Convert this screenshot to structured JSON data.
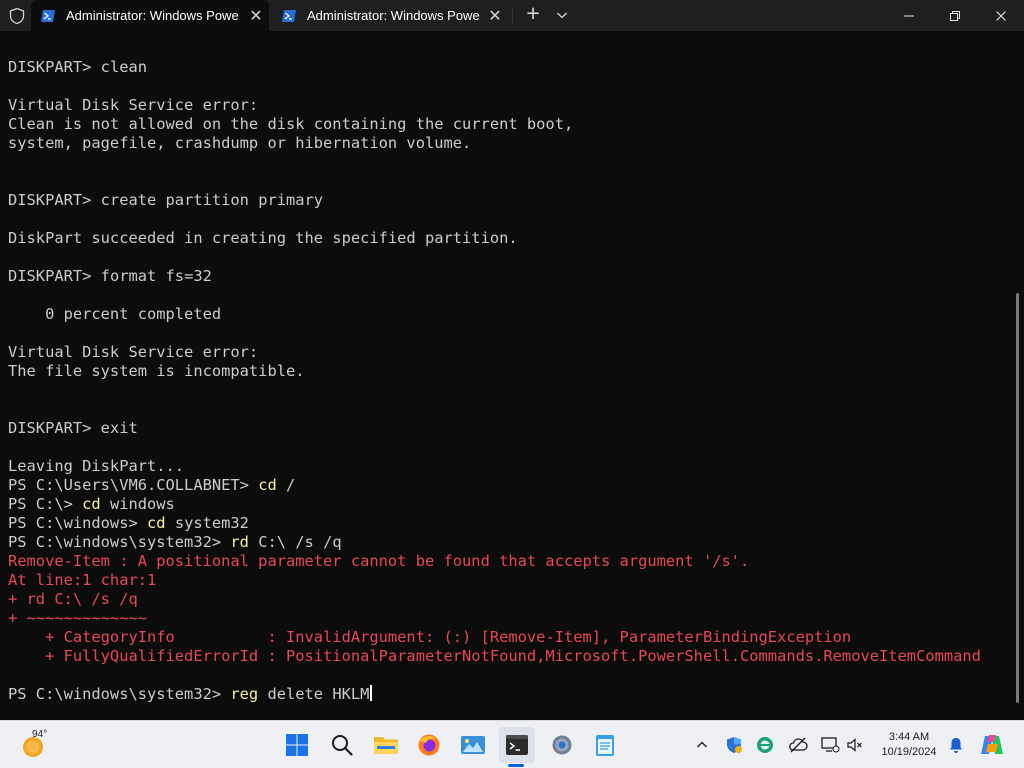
{
  "window": {
    "tabs": [
      {
        "label": "Administrator: Windows Powe",
        "close": "✕"
      },
      {
        "label": "Administrator: Windows Powe",
        "close": "✕"
      }
    ],
    "new_tab": "+",
    "icons": [
      "shield-icon",
      "powershell-icon",
      "chevron-down-icon",
      "minimize-icon",
      "maximize-icon",
      "close-icon"
    ]
  },
  "terminal": {
    "lines": [
      {
        "prompt": "DISKPART> ",
        "cmd": "clean"
      },
      {
        "text": "Virtual Disk Service error:"
      },
      {
        "text": "Clean is not allowed on the disk containing the current boot,"
      },
      {
        "text": "system, pagefile, crashdump or hibernation volume."
      },
      {
        "prompt": "DISKPART> ",
        "cmd": "create partition primary"
      },
      {
        "text": "DiskPart succeeded in creating the specified partition."
      },
      {
        "prompt": "DISKPART> ",
        "cmd": "format fs=32"
      },
      {
        "text": "    0 percent completed"
      },
      {
        "text": "Virtual Disk Service error:"
      },
      {
        "text": "The file system is incompatible."
      },
      {
        "prompt": "DISKPART> ",
        "cmd": "exit"
      },
      {
        "text": "Leaving DiskPart..."
      },
      {
        "prompt": "PS C:\\Users\\VM6.COLLABNET> ",
        "cmd": "cd",
        "arg": " /"
      },
      {
        "prompt": "PS C:\\> ",
        "cmd": "cd",
        "arg": " windows"
      },
      {
        "prompt": "PS C:\\windows> ",
        "cmd": "cd",
        "arg": " system32"
      },
      {
        "prompt": "PS C:\\windows\\system32> ",
        "cmd": "rd",
        "arg": " C:\\ /s /q"
      },
      {
        "error": "Remove-Item : A positional parameter cannot be found that accepts argument '/s'."
      },
      {
        "error": "At line:1 char:1"
      },
      {
        "error": "+ rd C:\\ /s /q"
      },
      {
        "error": "+ ~~~~~~~~~~~~~"
      },
      {
        "error": "    + CategoryInfo          : InvalidArgument: (:) [Remove-Item], ParameterBindingException"
      },
      {
        "error": "    + FullyQualifiedErrorId : PositionalParameterNotFound,Microsoft.PowerShell.Commands.RemoveItemCommand"
      },
      {
        "prompt": "PS C:\\windows\\system32> ",
        "cmd": "reg",
        "arg": " delete HKLM"
      }
    ],
    "colors": {
      "text": "#cccccc",
      "command": "#f9f1a5",
      "error": "#e74856",
      "background": "#0c0c0c"
    }
  },
  "taskbar": {
    "weather_temp": "94°",
    "apps": [
      "windows-start-icon",
      "search-icon",
      "file-explorer-icon",
      "firefox-icon",
      "photos-icon",
      "terminal-icon",
      "settings-icon",
      "notepad-icon"
    ],
    "tray": [
      "chevron-up-icon",
      "defender-icon",
      "edge-icon",
      "vpn-icon",
      "network-icon",
      "volume-muted-icon",
      "notification-bell-icon",
      "copilot-icon"
    ],
    "time": "3:44 AM",
    "date": "10/19/2024"
  }
}
